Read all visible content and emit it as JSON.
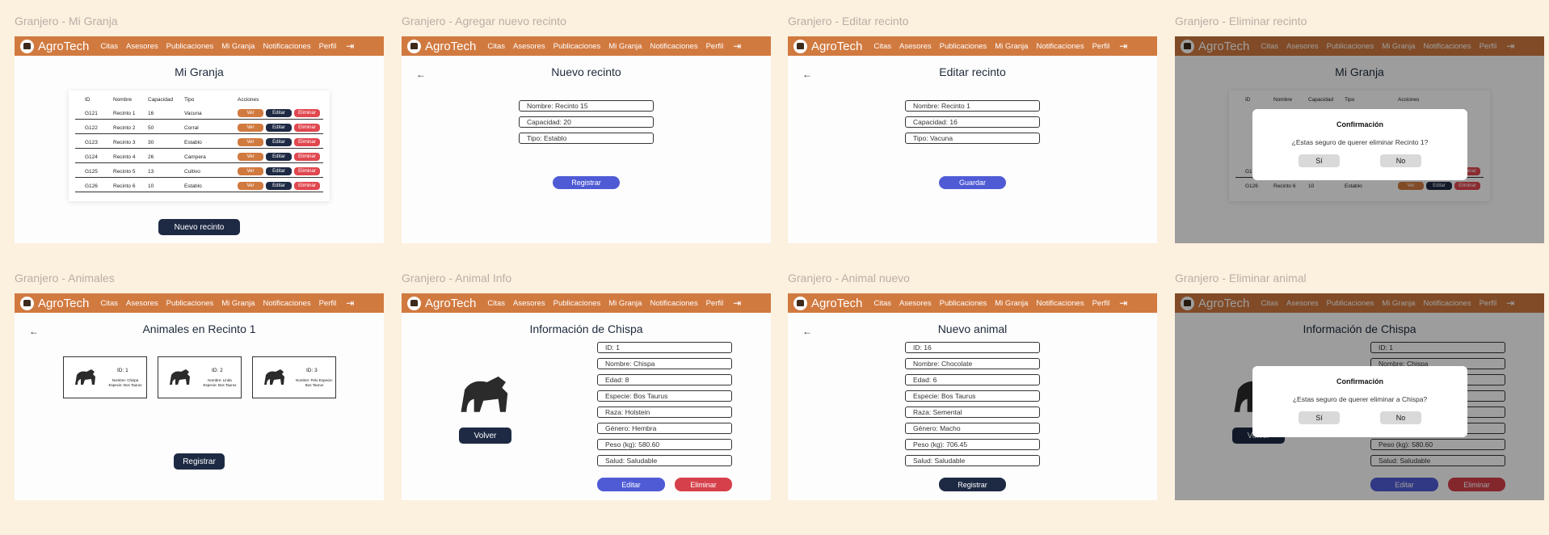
{
  "brand": "AgroTech",
  "nav": [
    "Citas",
    "Asesores",
    "Publicaciones",
    "Mi Granja",
    "Notificaciones",
    "Perfil"
  ],
  "frames": {
    "mi_granja": {
      "title": "Granjero - Mi Granja",
      "heading": "Mi Granja",
      "button": "Nuevo recinto"
    },
    "agregar": {
      "title": "Granjero - Agregar nuevo recinto",
      "heading": "Nuevo recinto",
      "fields": [
        "Nombre: Recinto 15",
        "Capacidad: 20",
        "Tipo: Establo"
      ],
      "button": "Registrar"
    },
    "editar": {
      "title": "Granjero - Editar recinto",
      "heading": "Editar recinto",
      "fields": [
        "Nombre: Recinto 1",
        "Capacidad: 16",
        "Tipo: Vacuna"
      ],
      "button": "Guardar"
    },
    "eliminar_recinto": {
      "title": "Granjero - Eliminar recinto",
      "heading": "Mi Granja",
      "modal_title": "Confirmación",
      "modal_question": "¿Estas seguro de querer eliminar Recinto 1?",
      "yes": "Sí",
      "no": "No"
    },
    "animales": {
      "title": "Granjero - Animales",
      "heading": "Animales en Recinto 1",
      "button": "Registrar",
      "cards": [
        {
          "id": "ID: 1",
          "info": "Nombre: Chispa Especie: Bos Taurus"
        },
        {
          "id": "ID: 2",
          "info": "Nombre: Linda Especie: Bos Taurus"
        },
        {
          "id": "ID: 3",
          "info": "Nombre: Pelo Especie: Bos Taurus"
        }
      ]
    },
    "animal_info": {
      "title": "Granjero - Animal Info",
      "heading": "Información de Chispa",
      "back_button": "Volver",
      "edit": "Editar",
      "delete": "Eliminar",
      "fields": [
        "ID: 1",
        "Nombre: Chispa",
        "Edad: 8",
        "Especie: Bos Taurus",
        "Raza: Holstein",
        "Género: Hembra",
        "Peso (kg): 580.60",
        "Salud: Saludable"
      ]
    },
    "animal_nuevo": {
      "title": "Granjero - Animal nuevo",
      "heading": "Nuevo animal",
      "button": "Registrar",
      "fields": [
        "ID: 16",
        "Nombre: Chocolate",
        "Edad: 6",
        "Especie: Bos Taurus",
        "Raza: Semental",
        "Género: Macho",
        "Peso (kg): 706.45",
        "Salud: Saludable"
      ]
    },
    "eliminar_animal": {
      "title": "Granjero - Eliminar animal",
      "heading": "Información de Chispa",
      "back_button": "Volver",
      "edit": "Editar",
      "delete": "Eliminar",
      "fields": [
        "ID: 1",
        "Nombre: Chispa",
        "Edad: 8",
        "Especie: Bos Taurus",
        "Raza: Holstein",
        "Género: Hembra",
        "Peso (kg): 580.60",
        "Salud: Saludable"
      ],
      "modal_title": "Confirmación",
      "modal_question": "¿Estas seguro de querer eliminar a Chispa?",
      "yes": "Sí",
      "no": "No"
    }
  },
  "table": {
    "headers": [
      "ID",
      "Nombre",
      "Capacidad",
      "Tipo",
      "Acciones"
    ],
    "rows": [
      [
        "G121",
        "Recinto 1",
        "16",
        "Vacuna"
      ],
      [
        "G122",
        "Recinto 2",
        "50",
        "Corral"
      ],
      [
        "G123",
        "Recinto 3",
        "30",
        "Establo"
      ],
      [
        "G124",
        "Recinto 4",
        "26",
        "Campera"
      ],
      [
        "G125",
        "Recinto 5",
        "13",
        "Cultivo"
      ],
      [
        "G126",
        "Recinto 6",
        "10",
        "Establo"
      ]
    ],
    "actions": [
      "Ver",
      "Editar",
      "Eliminar"
    ]
  },
  "colors": {
    "background": "#fcf0df",
    "navbar": "#d17a40",
    "dark_button": "#1e2a44",
    "blue_button": "#4f5bd5",
    "red_button": "#e0474f"
  }
}
